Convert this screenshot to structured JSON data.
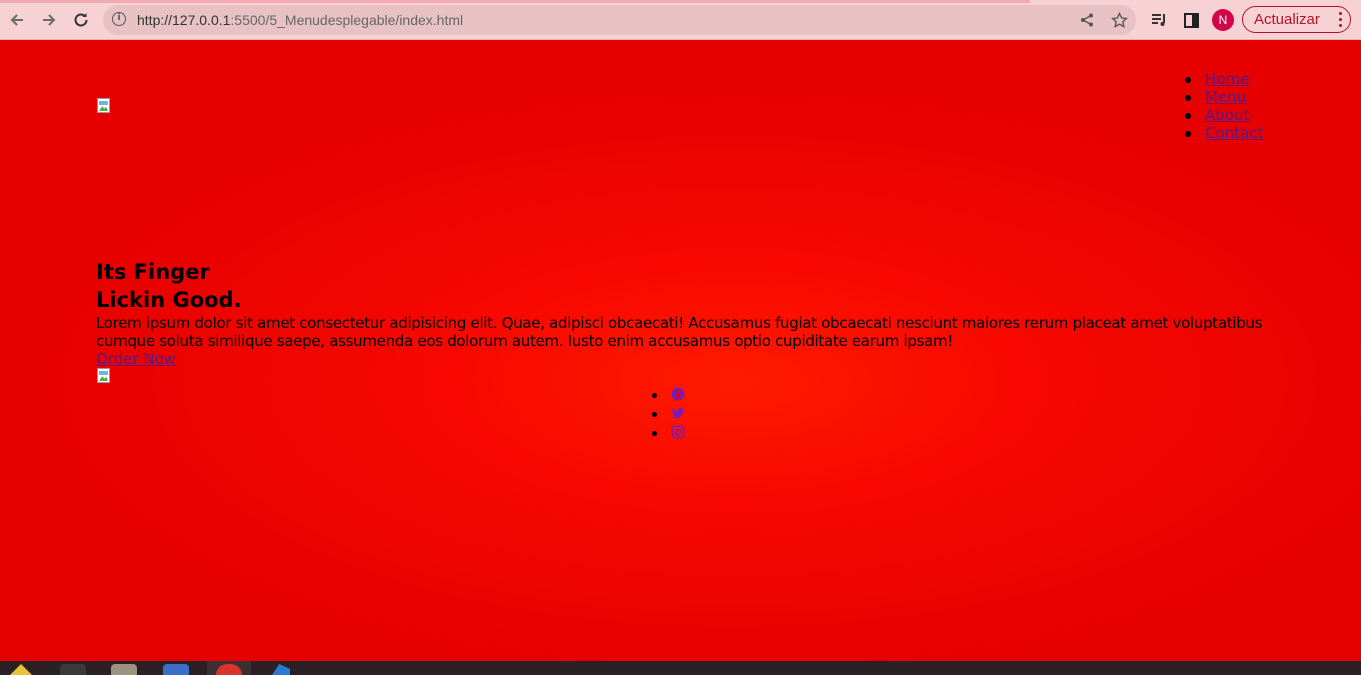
{
  "browser": {
    "url_host": "http://127.0.0.1",
    "url_rest": ":5500/5_Menudesplegable/index.html",
    "profile_initial": "N",
    "update_label": "Actualizar"
  },
  "page": {
    "nav": [
      "Home",
      "Menu",
      "About",
      "Contact"
    ],
    "hero": {
      "title_line1": "Its Finger",
      "title_line2": "Lickin Good.",
      "text": "Lorem ipsum dolor sit amet consectetur adipisicing elit. Quae, adipisci obcaecati! Accusamus fugiat obcaecati nesciunt maiores rerum placeat amet voluptatibus cumque soluta similique saepe, assumenda eos dolorum autem. Iusto enim accusamus optio cupiditate earum ipsam!",
      "cta": "Order Now"
    },
    "social_icons": [
      "facebook-icon",
      "twitter-icon",
      "instagram-icon"
    ]
  },
  "colors": {
    "page_background": "#e80000",
    "link": "#551a8b",
    "chrome_background": "#f6d2d5",
    "update_accent": "#b3122a"
  }
}
